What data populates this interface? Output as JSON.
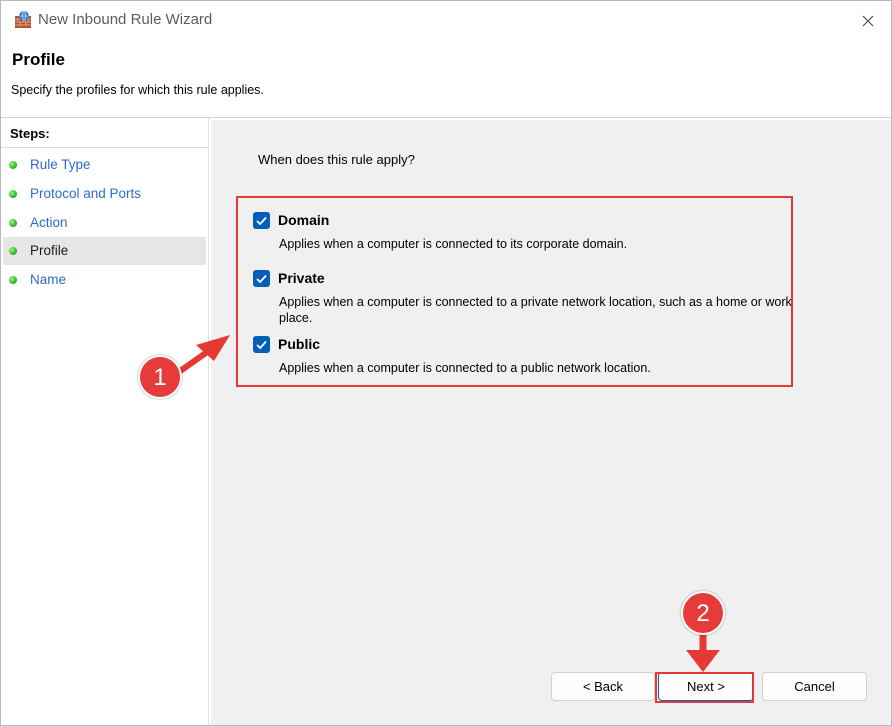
{
  "window": {
    "title": "New Inbound Rule Wizard",
    "icon": "firewall-icon",
    "close_icon": "close-icon"
  },
  "header": {
    "title": "Profile",
    "subtitle": "Specify the profiles for which this rule applies."
  },
  "steps": {
    "heading": "Steps:",
    "items": [
      {
        "label": "Rule Type",
        "active": false
      },
      {
        "label": "Protocol and Ports",
        "active": false
      },
      {
        "label": "Action",
        "active": false
      },
      {
        "label": "Profile",
        "active": true
      },
      {
        "label": "Name",
        "active": false
      }
    ]
  },
  "main": {
    "question": "When does this rule apply?",
    "profiles": [
      {
        "name": "Domain",
        "checked": true,
        "description": "Applies when a computer is connected to its corporate domain."
      },
      {
        "name": "Private",
        "checked": true,
        "description": "Applies when a computer is connected to a private network location, such as a home or work place."
      },
      {
        "name": "Public",
        "checked": true,
        "description": "Applies when a computer is connected to a public network location."
      }
    ]
  },
  "buttons": {
    "back": "< Back",
    "next": "Next >",
    "cancel": "Cancel"
  },
  "annotations": {
    "marker_1": "1",
    "marker_2": "2",
    "color": "#e53935"
  },
  "colors": {
    "accent": "#005fb8",
    "link": "#2e6bd1",
    "step_dot": "#33b82c",
    "right_pane_bg": "#f0f0f0"
  }
}
